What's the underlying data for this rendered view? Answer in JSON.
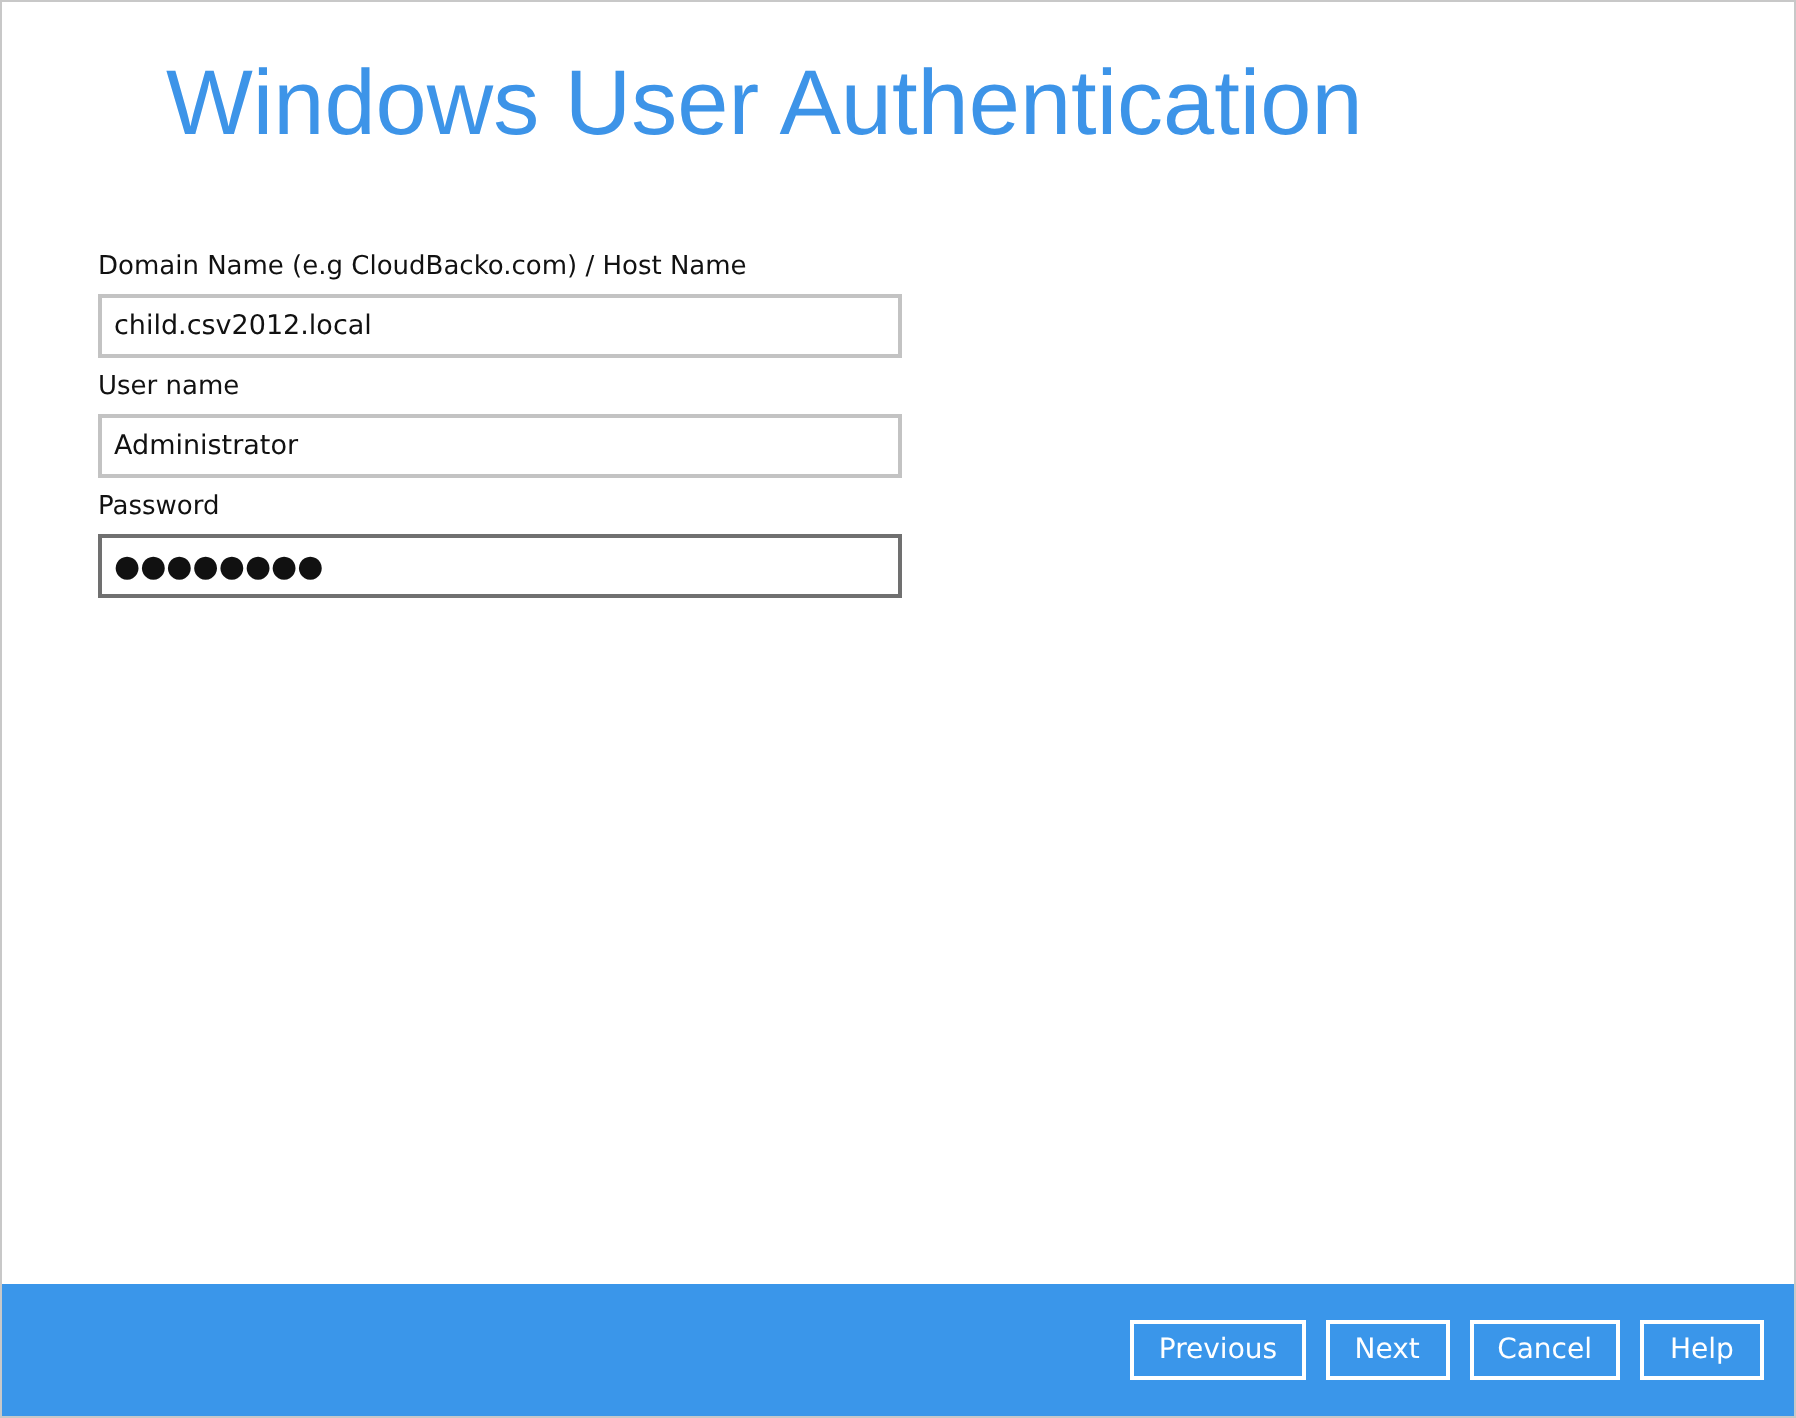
{
  "title": "Windows User Authentication",
  "fields": [
    {
      "label": "Domain Name (e.g CloudBacko.com) / Host Name",
      "value": "child.csv2012.local",
      "kind": "text",
      "focused": false
    },
    {
      "label": "User name",
      "value": "Administrator",
      "kind": "text",
      "focused": false
    },
    {
      "label": "Password",
      "value": "●●●●●●●●",
      "kind": "password",
      "focused": true
    }
  ],
  "buttons": [
    "Previous",
    "Next",
    "Cancel",
    "Help"
  ]
}
